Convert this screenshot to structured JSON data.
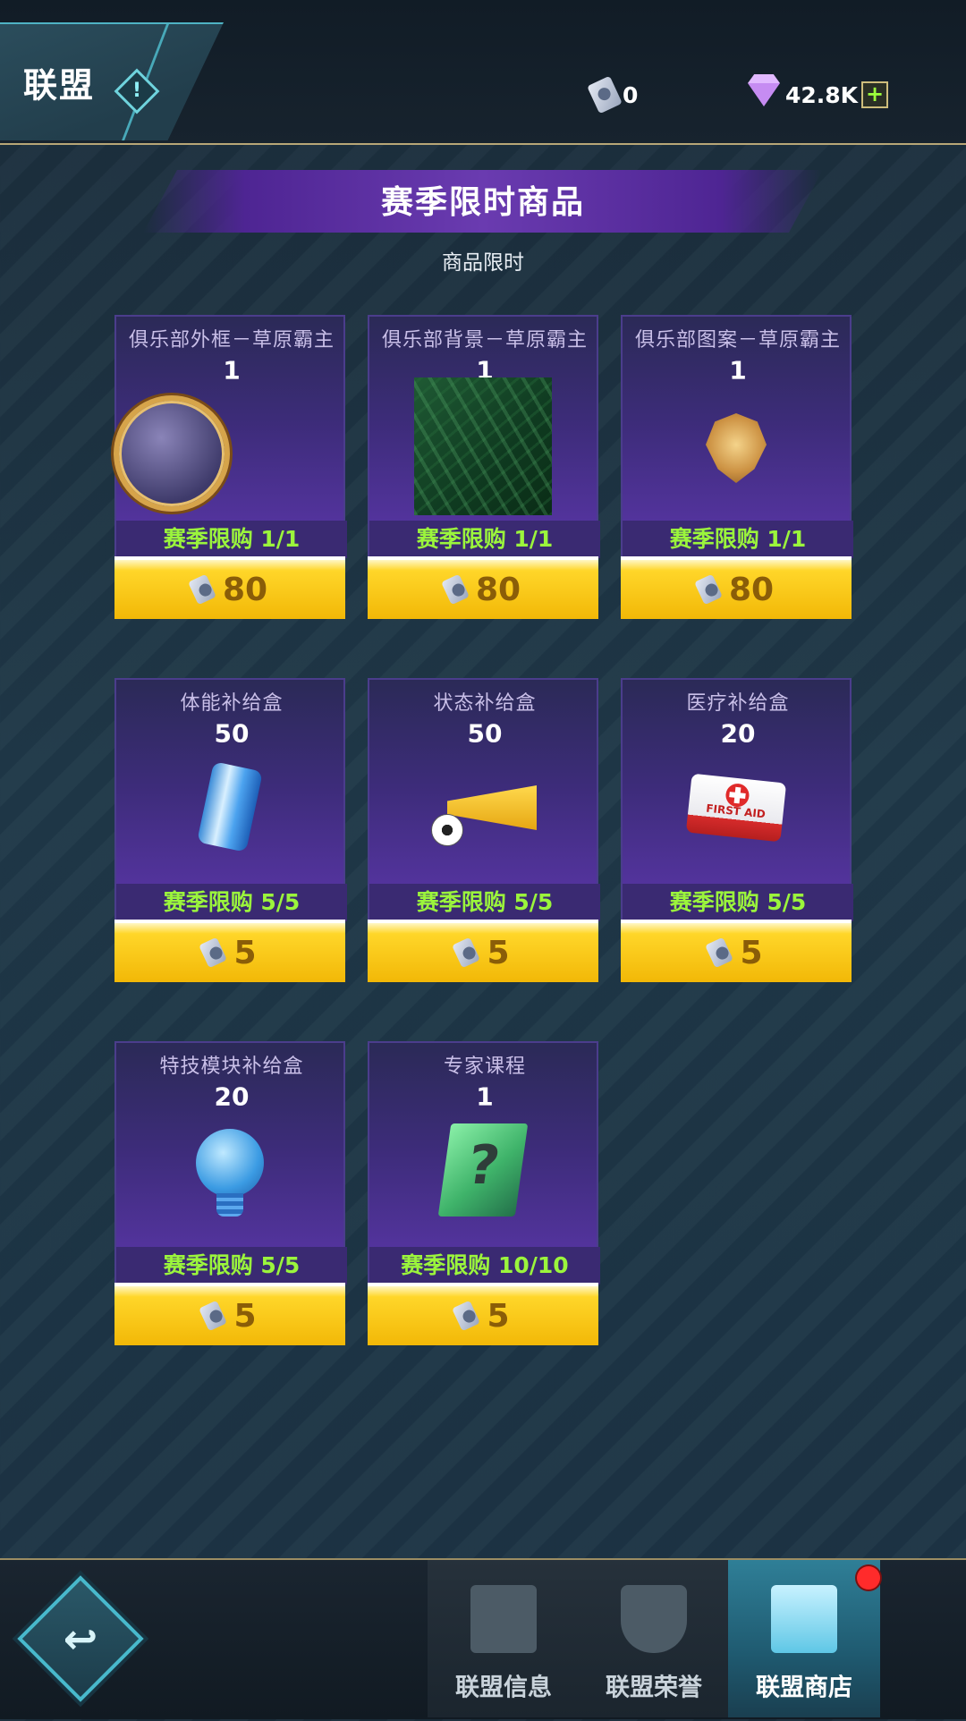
{
  "header": {
    "title": "联盟",
    "info_icon": "info-icon",
    "ticket_balance": "0",
    "gem_balance": "42.8K",
    "add_gems_label": "+"
  },
  "shop": {
    "banner_title": "赛季限时商品",
    "subtitle": "商品限时",
    "items": [
      {
        "name": "俱乐部外框－草原霸主",
        "qty": "1",
        "limit": "赛季限购 1/1",
        "price": "80",
        "icon": "ring-frame-icon"
      },
      {
        "name": "俱乐部背景－草原霸主",
        "qty": "1",
        "limit": "赛季限购 1/1",
        "price": "80",
        "icon": "leaf-background-icon"
      },
      {
        "name": "俱乐部图案－草原霸主",
        "qty": "1",
        "limit": "赛季限购 1/1",
        "price": "80",
        "icon": "lion-emblem-icon"
      },
      {
        "name": "体能补给盒",
        "qty": "50",
        "limit": "赛季限购 5/5",
        "price": "5",
        "icon": "energy-can-icon"
      },
      {
        "name": "状态补给盒",
        "qty": "50",
        "limit": "赛季限购 5/5",
        "price": "5",
        "icon": "horn-ball-icon"
      },
      {
        "name": "医疗补给盒",
        "qty": "20",
        "limit": "赛季限购 5/5",
        "price": "5",
        "icon": "first-aid-kit-icon"
      },
      {
        "name": "特技模块补给盒",
        "qty": "20",
        "limit": "赛季限购 5/5",
        "price": "5",
        "icon": "lightbulb-ball-icon"
      },
      {
        "name": "专家课程",
        "qty": "1",
        "limit": "赛季限购 10/10",
        "price": "5",
        "icon": "mystery-book-icon"
      }
    ],
    "first_aid_text": "FIRST AID",
    "mystery_mark": "?"
  },
  "bottom_nav": {
    "back_icon": "back-arrow-icon",
    "back_glyph": "↩",
    "tabs": [
      {
        "label": "联盟信息",
        "icon": "league-info-icon"
      },
      {
        "label": "联盟荣誉",
        "icon": "trophy-icon"
      },
      {
        "label": "联盟商店",
        "icon": "shop-icon",
        "active": true,
        "has_notification": true
      }
    ]
  },
  "colors": {
    "accent_cyan": "#48b9cc",
    "limit_green": "#9bf53c",
    "price_yellow": "#ffd629",
    "card_purple": "#5a36a8",
    "notification_red": "#ff2b2b"
  }
}
